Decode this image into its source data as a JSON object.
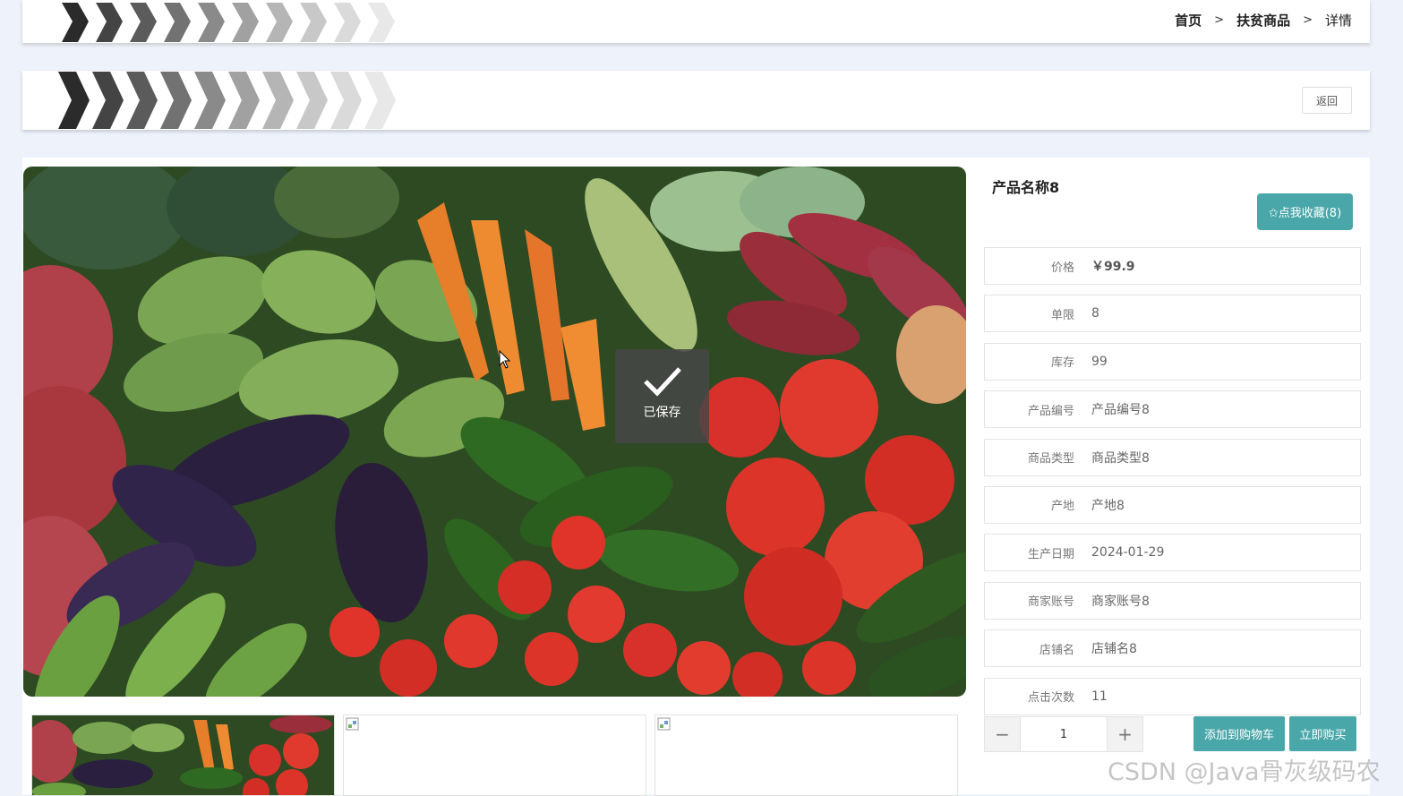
{
  "breadcrumb": {
    "items": [
      "首页",
      "扶贫商品",
      "详情"
    ],
    "separator": ">"
  },
  "toolbar": {
    "back_label": "返回"
  },
  "toast": {
    "message": "已保存",
    "icon": "check-icon"
  },
  "product": {
    "name": "产品名称8",
    "favorite_label": "✩点我收藏(8)",
    "fields": [
      {
        "label": "价格",
        "value": "￥99.9"
      },
      {
        "label": "单限",
        "value": "8"
      },
      {
        "label": "库存",
        "value": "99"
      },
      {
        "label": "产品编号",
        "value": "产品编号8"
      },
      {
        "label": "商品类型",
        "value": "商品类型8"
      },
      {
        "label": "产地",
        "value": "产地8"
      },
      {
        "label": "生产日期",
        "value": "2024-01-29"
      },
      {
        "label": "商家账号",
        "value": "商家账号8"
      },
      {
        "label": "店铺名",
        "value": "店铺名8"
      },
      {
        "label": "点击次数",
        "value": "11"
      }
    ]
  },
  "quantity": {
    "value": "1",
    "minus": "−",
    "plus": "+"
  },
  "actions": {
    "add_to_cart": "添加到购物车",
    "buy_now": "立即购买"
  },
  "watermark": "CSDN @Java骨灰级码农",
  "colors": {
    "accent": "#4aa7a9",
    "page_bg": "#eef3fb"
  }
}
